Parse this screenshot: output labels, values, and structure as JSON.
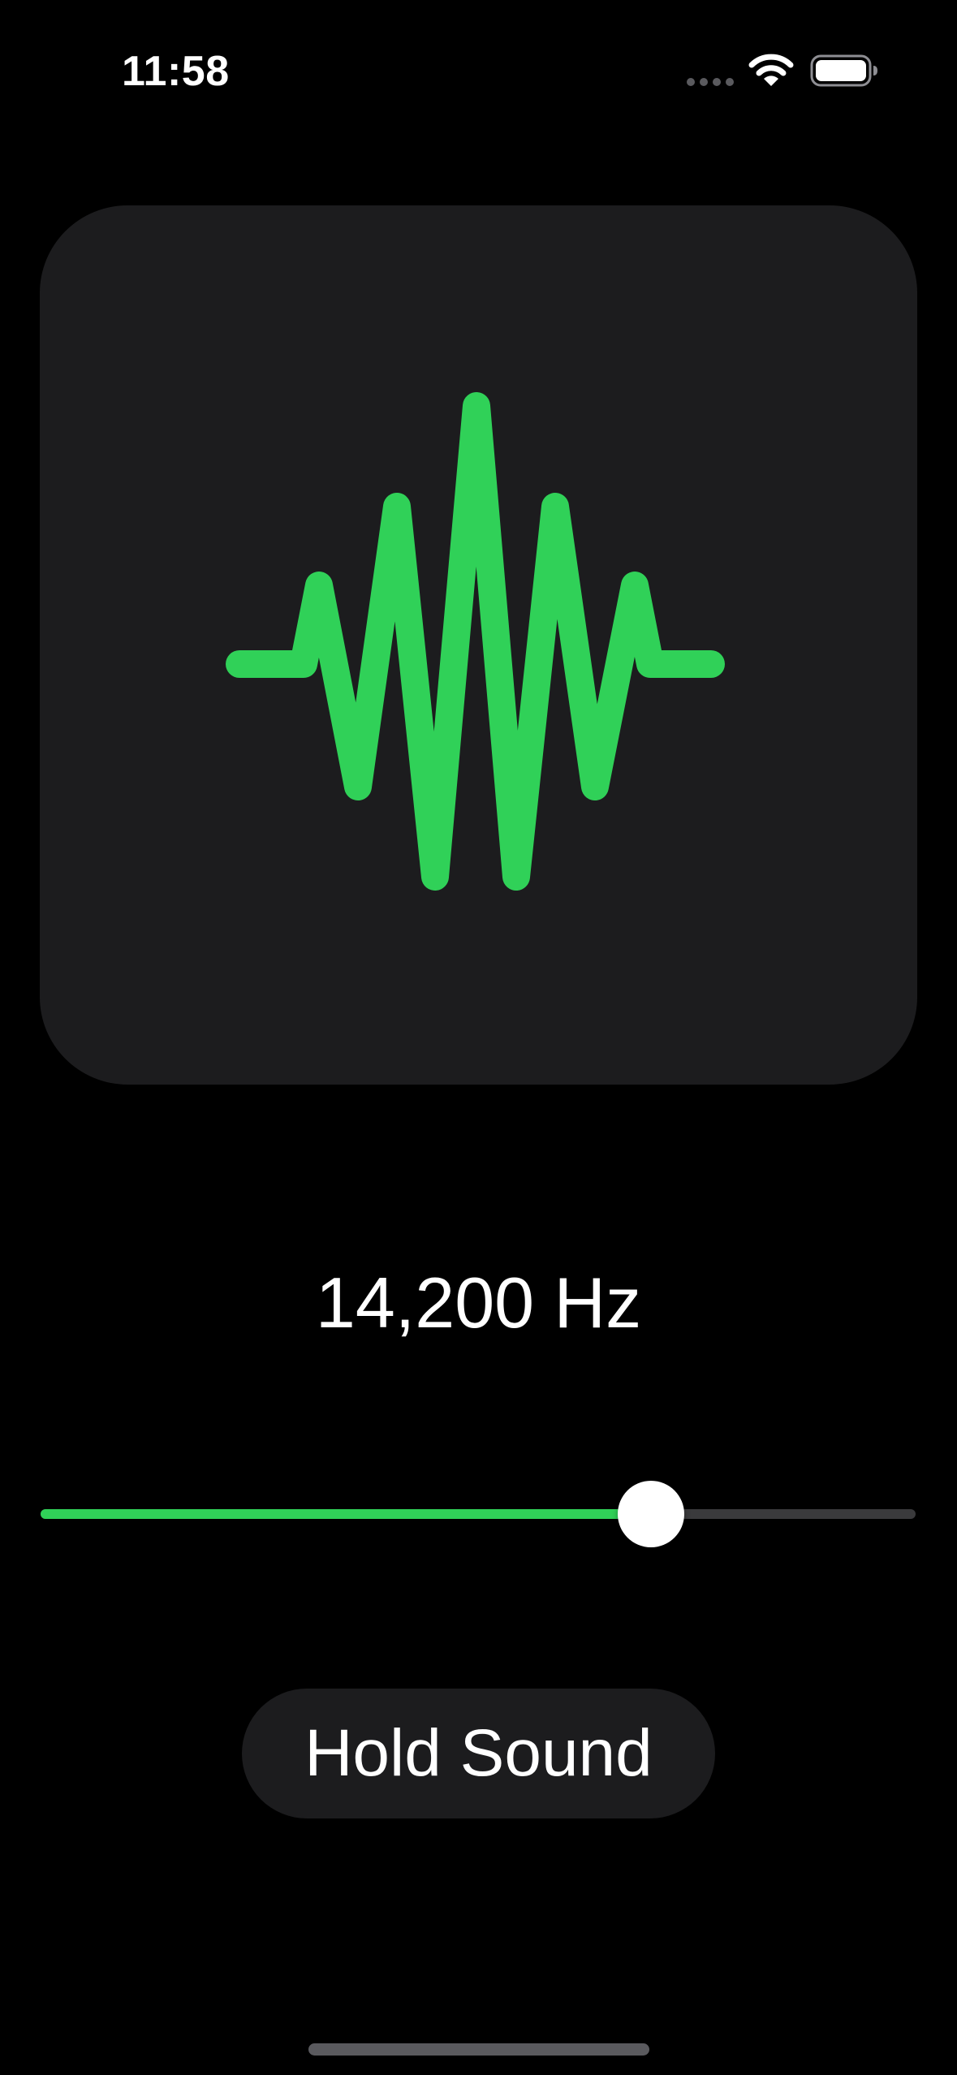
{
  "status_bar": {
    "time": "11:58",
    "icons": [
      "signal-dots-icon",
      "wifi-icon",
      "battery-icon"
    ]
  },
  "visualizer": {
    "icon": "waveform-icon",
    "stroke_color": "#30d158",
    "card_color": "#1c1c1e"
  },
  "frequency": {
    "label": "14,200 Hz"
  },
  "slider": {
    "fraction": 0.698,
    "fill_color": "#30d158",
    "track_color": "#3a3a3c"
  },
  "hold_button": {
    "label": "Hold Sound"
  },
  "colors": {
    "accent": "#30d158",
    "background": "#000000"
  }
}
